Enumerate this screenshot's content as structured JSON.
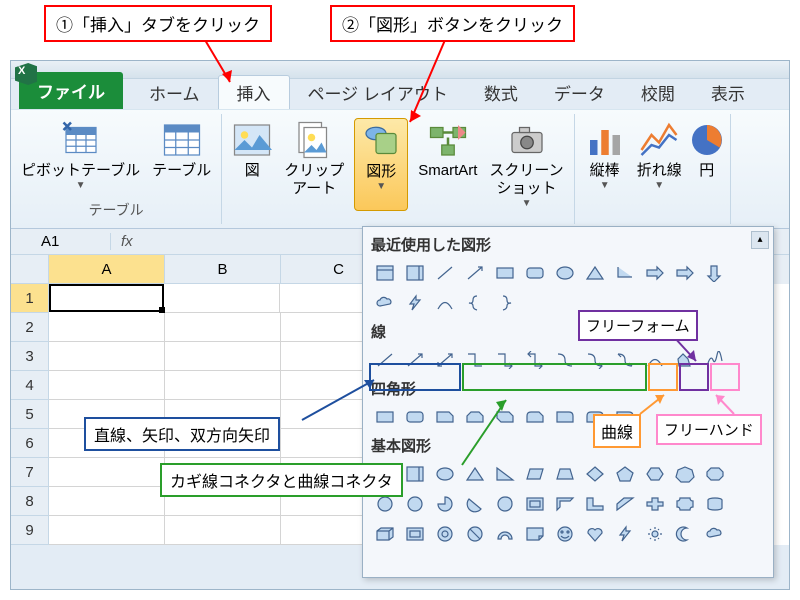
{
  "callouts": {
    "c1": "①「挿入」タブをクリック",
    "c2": "②「図形」ボタンをクリック",
    "straight": "直線、矢印、双方向矢印",
    "connectors": "カギ線コネクタと曲線コネクタ",
    "curve": "曲線",
    "freeform": "フリーフォーム",
    "freehand": "フリーハンド"
  },
  "tabs": {
    "file": "ファイル",
    "home": "ホーム",
    "insert": "挿入",
    "layout": "ページ レイアウト",
    "formula": "数式",
    "data": "データ",
    "review": "校閲",
    "view": "表示"
  },
  "ribbon": {
    "pivot": "ピボットテーブル",
    "table": "テーブル",
    "tables_group": "テーブル",
    "picture": "図",
    "clipart": "クリップ\nアート",
    "shapes": "図形",
    "smartart": "SmartArt",
    "screenshot": "スクリーン\nショット",
    "column": "縦棒",
    "line": "折れ線",
    "pie": "円"
  },
  "namebox": "A1",
  "cols": [
    "A",
    "B",
    "C"
  ],
  "rows": [
    "1",
    "2",
    "3",
    "4",
    "5",
    "6",
    "7",
    "8",
    "9"
  ],
  "shapes_menu": {
    "recent": "最近使用した図形",
    "lines": "線",
    "rects": "四角形",
    "basic": "基本図形"
  }
}
